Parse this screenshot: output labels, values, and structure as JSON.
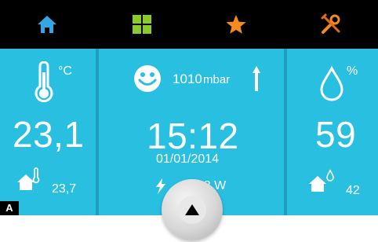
{
  "colors": {
    "background": "#29bfe0",
    "topbar": "#000000",
    "home_icon": "#33a6e6",
    "grid_icon": "#8acb2b",
    "star_icon": "#f58b1f",
    "tools_icon": "#f58b1f"
  },
  "icons": {
    "home": "home-icon",
    "grid": "grid-icon",
    "favorites": "star-icon",
    "settings": "tools-icon",
    "thermometer": "thermometer-icon",
    "smiley": "smiley-icon",
    "pressure_trend": "arrow-up-icon",
    "drop": "drop-icon",
    "indoor_temp": "house-thermometer-icon",
    "power": "lightning-icon",
    "indoor_humidity": "house-drop-icon",
    "fab": "triangle-up-icon"
  },
  "temperature": {
    "unit": "°C",
    "outdoor_value": "23,1",
    "indoor_value": "23,7"
  },
  "center": {
    "pressure": "1010",
    "pressure_unit": "mbar",
    "time": "15:12",
    "date": "01/01/2014",
    "power": "523 W"
  },
  "humidity": {
    "unit": "%",
    "outdoor_value": "59",
    "indoor_value": "42"
  },
  "corner_label": "A"
}
